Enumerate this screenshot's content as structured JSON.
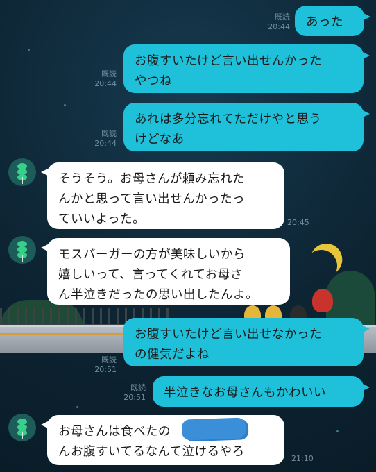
{
  "messages": [
    {
      "side": "out",
      "text": "あった",
      "read": "既読",
      "time": "20:44"
    },
    {
      "side": "out",
      "text": "お腹すいたけど言い出せんかった\nやつね",
      "read": "既読",
      "time": "20:44"
    },
    {
      "side": "out",
      "text": "あれは多分忘れてただけやと思う\nけどなあ",
      "read": "既読",
      "time": "20:44"
    },
    {
      "side": "in",
      "text": "そうそう。お母さんが頼み忘れた\nんかと思って言い出せんかったっ\nていいよった。",
      "time": "20:45"
    },
    {
      "side": "in",
      "text": "モスバーガーの方が美味しいから\n嬉しいって、言ってくれてお母さ\nん半泣きだったの思い出したんよ。",
      "time": ""
    },
    {
      "side": "out",
      "text": "お腹すいたけど言い出せなかった\nの健気だよね",
      "read": "既読",
      "time": "20:51"
    },
    {
      "side": "out",
      "text": "半泣きなお母さんもかわいい",
      "read": "既読",
      "time": "20:51"
    },
    {
      "side": "in",
      "text": "お母さんは食べたの　　　　ちゃ\nんお腹すいてるなんて泣けるやろ",
      "time": "21:10"
    }
  ],
  "contact": {
    "avatar_icon": "dango-icon"
  },
  "colors": {
    "outgoing": "#1fc0d9",
    "incoming": "#ffffff",
    "background": "#0f2a3a"
  }
}
